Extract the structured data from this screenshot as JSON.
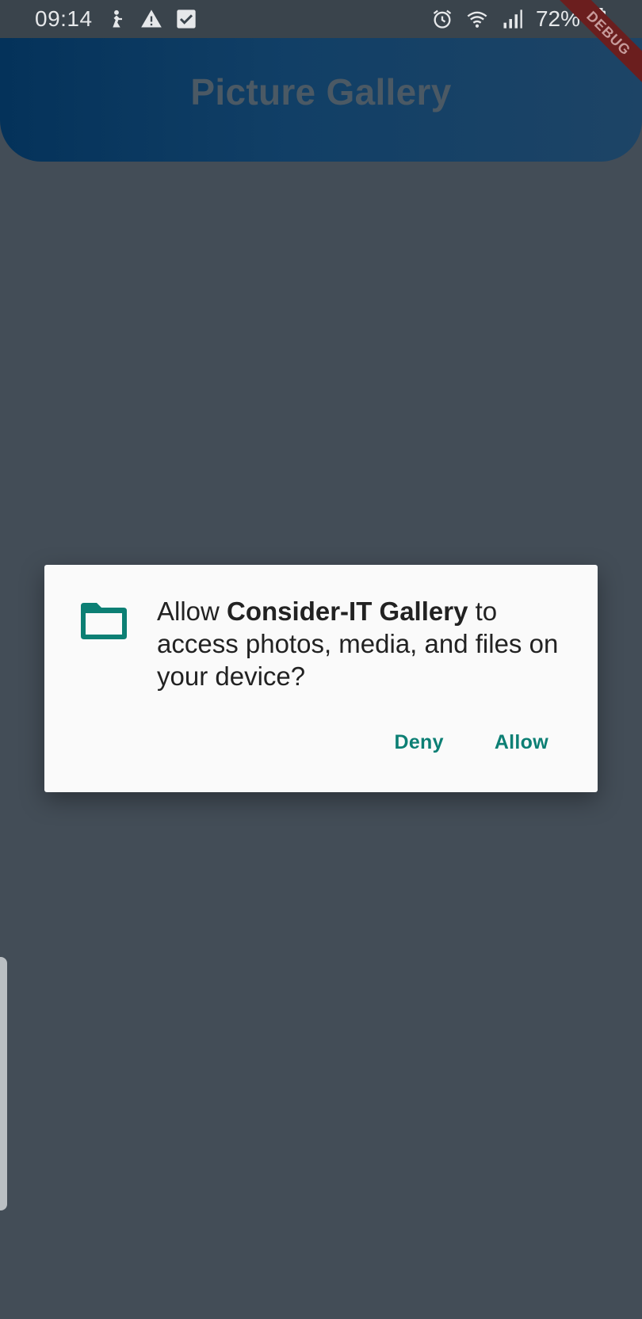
{
  "status_bar": {
    "time": "09:14",
    "battery_pct": "72%",
    "icons_left": [
      "person-run-icon",
      "warning-icon",
      "checkbox-icon"
    ],
    "icons_right": [
      "alarm-icon",
      "wifi-icon",
      "signal-icon",
      "battery-icon"
    ]
  },
  "app_bar": {
    "title": "Picture Gallery"
  },
  "debug_banner": "DEBUG",
  "dialog": {
    "icon": "folder-icon",
    "message_prefix": "Allow ",
    "app_name": "Consider-IT Gallery",
    "message_suffix": " to access photos, media, and files on your device?",
    "deny_label": "Deny",
    "allow_label": "Allow"
  },
  "colors": {
    "scrim_background": "#434d57",
    "app_bar_blue": "#04325a",
    "accent_teal": "#0c7f74",
    "dialog_background": "#fafafa"
  }
}
